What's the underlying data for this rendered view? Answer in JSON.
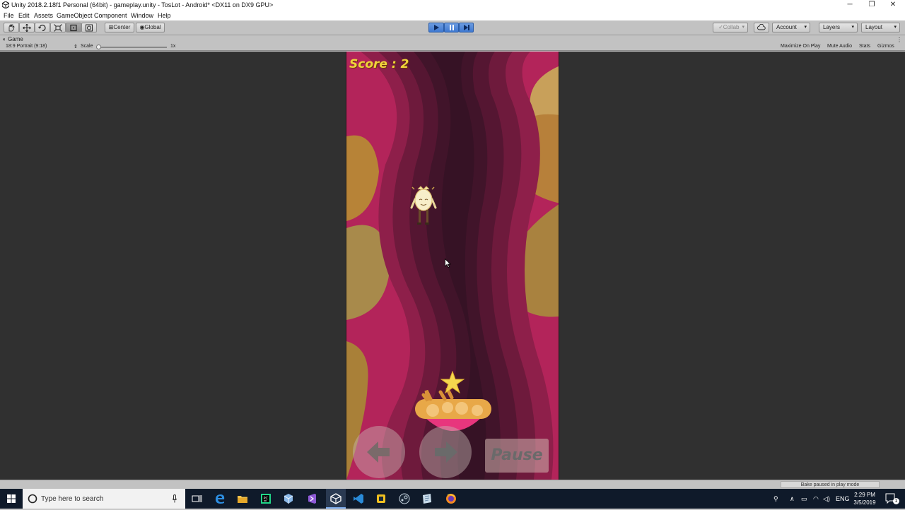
{
  "window": {
    "title": "Unity 2018.2.18f1 Personal (64bit) - gameplay.unity - TosLot - Android* <DX11 on DX9 GPU>",
    "minimize": "─",
    "restore": "❐",
    "close": "✕"
  },
  "menu": [
    "File",
    "Edit",
    "Assets",
    "GameObject",
    "Component",
    "Window",
    "Help"
  ],
  "toolbar": {
    "pivot_label": "Center",
    "space_label": "Global",
    "collab_label": "Collab",
    "account_label": "Account",
    "layers_label": "Layers",
    "layout_label": "Layout"
  },
  "game_view": {
    "tab_label": "Game",
    "aspect_label": "18:9 Portrait (9:18)",
    "scale_label": "Scale",
    "scale_value": "1x",
    "maximize_label": "Maximize On Play",
    "mute_label": "Mute Audio",
    "stats_label": "Stats",
    "gizmos_label": "Gizmos"
  },
  "game": {
    "score_text": "Score : 2",
    "pause_label": "Pause"
  },
  "status": {
    "message": "Bake paused in play mode"
  },
  "taskbar": {
    "search_placeholder": "Type here to search",
    "language": "ENG",
    "time": "2:29 PM",
    "date": "3/5/2019",
    "notification_count": "1"
  },
  "colors": {
    "play_active": "#3f79d1",
    "editor_bg": "#303030",
    "canvas_pink": "#b3245a",
    "score_yellow": "#f0d43a"
  }
}
